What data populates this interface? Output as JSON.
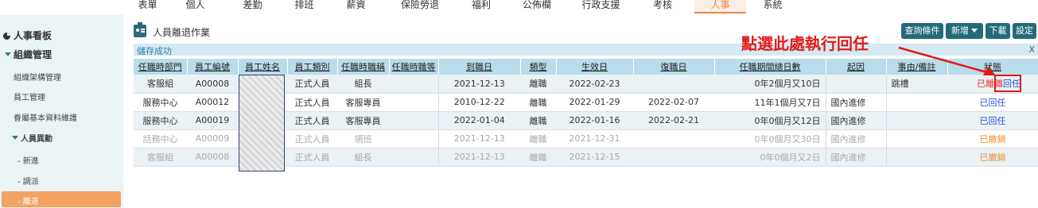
{
  "topnav": [
    {
      "label": "表單"
    },
    {
      "label": "個人"
    },
    {
      "label": "差勤"
    },
    {
      "label": "排班"
    },
    {
      "label": "薪資"
    },
    {
      "label": "保險勞退"
    },
    {
      "label": "福利"
    },
    {
      "label": "公佈欄"
    },
    {
      "label": "行政支援"
    },
    {
      "label": "考核"
    },
    {
      "label": "人事",
      "active": true
    },
    {
      "label": "系統"
    }
  ],
  "sidebar": {
    "title": "人事看板",
    "section": "組織管理",
    "items": [
      "組織架構管理",
      "員工管理",
      "眷屬基本資料維護"
    ],
    "subsection": "人員異動",
    "subitems": [
      "- 新進",
      "- 調派",
      "- 離退"
    ]
  },
  "page": {
    "title": "人員離退作業"
  },
  "toolbar": {
    "query": "查詢條件",
    "add": "新增",
    "download": "下載",
    "settings": "設定"
  },
  "status": {
    "message": "儲存成功",
    "close": "X"
  },
  "table": {
    "headers": [
      "任職時部門",
      "員工編號",
      "員工姓名",
      "員工類別",
      "任職時職稱",
      "任職時職等",
      "到職日",
      "類型",
      "生效日",
      "復職日",
      "任職期間總日數",
      "起因",
      "事由/備註",
      "狀態"
    ],
    "rows": [
      {
        "dept": "客服組",
        "id": "A00008",
        "name": "",
        "category": "正式人員",
        "title": "組長",
        "grade": "",
        "start": "2021-12-13",
        "type": "離職",
        "effective": "2022-02-23",
        "reinstate": "",
        "duration": "0年2個月又10日",
        "cause": "",
        "reason": "跳槽",
        "status": "已離職",
        "action": "回任"
      },
      {
        "dept": "服務中心",
        "id": "A00012",
        "name": "",
        "category": "正式人員",
        "title": "客服專員",
        "grade": "",
        "start": "2010-12-22",
        "type": "離職",
        "effective": "2022-01-29",
        "reinstate": "2022-02-07",
        "duration": "11年1個月又7日",
        "cause": "國內進修",
        "reason": "",
        "status": "已回任",
        "action": ""
      },
      {
        "dept": "服務中心",
        "id": "A00019",
        "name": "",
        "category": "正式人員",
        "title": "客服專員",
        "grade": "",
        "start": "2022-01-04",
        "type": "離職",
        "effective": "2022-01-16",
        "reinstate": "2022-02-21",
        "duration": "0年0個月又12日",
        "cause": "國內進修",
        "reason": "",
        "status": "已回任",
        "action": ""
      },
      {
        "dept": "話務中心",
        "id": "A00009",
        "name": "",
        "category": "正式人員",
        "title": "領班",
        "grade": "",
        "start": "2021-12-13",
        "type": "離職",
        "effective": "2021-12-31",
        "reinstate": "",
        "duration": "0年0個月又30日",
        "cause": "國內進修",
        "reason": "",
        "status": "已撤銷",
        "action": ""
      },
      {
        "dept": "客服組",
        "id": "A00008",
        "name": "",
        "category": "正式人員",
        "title": "組長",
        "grade": "",
        "start": "2021-12-13",
        "type": "離職",
        "effective": "2021-12-15",
        "reinstate": "",
        "duration": "0年0個月又2日",
        "cause": "國內進修",
        "reason": "",
        "status": "已撤銷",
        "action": ""
      }
    ]
  },
  "annotation": {
    "text": "點選此處執行回任"
  },
  "colors": {
    "accent": "#f4a261",
    "button": "#236b79",
    "header": "#b9dcea",
    "annotation": "#e01a1a"
  }
}
